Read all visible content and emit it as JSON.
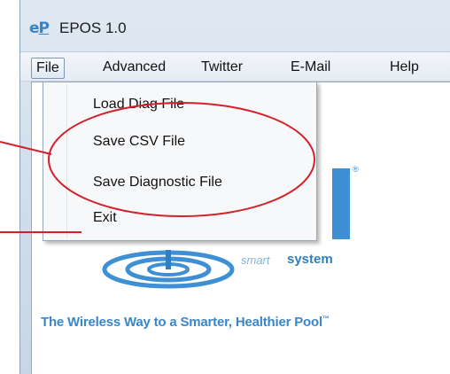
{
  "window": {
    "icon_glyph_e": "e",
    "icon_glyph_p": "P",
    "title": "EPOS 1.0"
  },
  "menubar": {
    "items": [
      "File",
      "Advanced",
      "Twitter",
      "E-Mail",
      "Help"
    ]
  },
  "file_menu": {
    "items": [
      "Load Diag File",
      "Save CSV File",
      "Save Diagnostic File",
      "Exit"
    ]
  },
  "branding": {
    "logo_fragment": "",
    "registered_mark": "®",
    "smart": "smart",
    "system": "system",
    "tagline": "The Wireless Way to a Smarter, Healthier Pool",
    "trademark": "™"
  },
  "colors": {
    "annotation_red": "#d3202b",
    "brand_blue": "#3f8fd4"
  }
}
